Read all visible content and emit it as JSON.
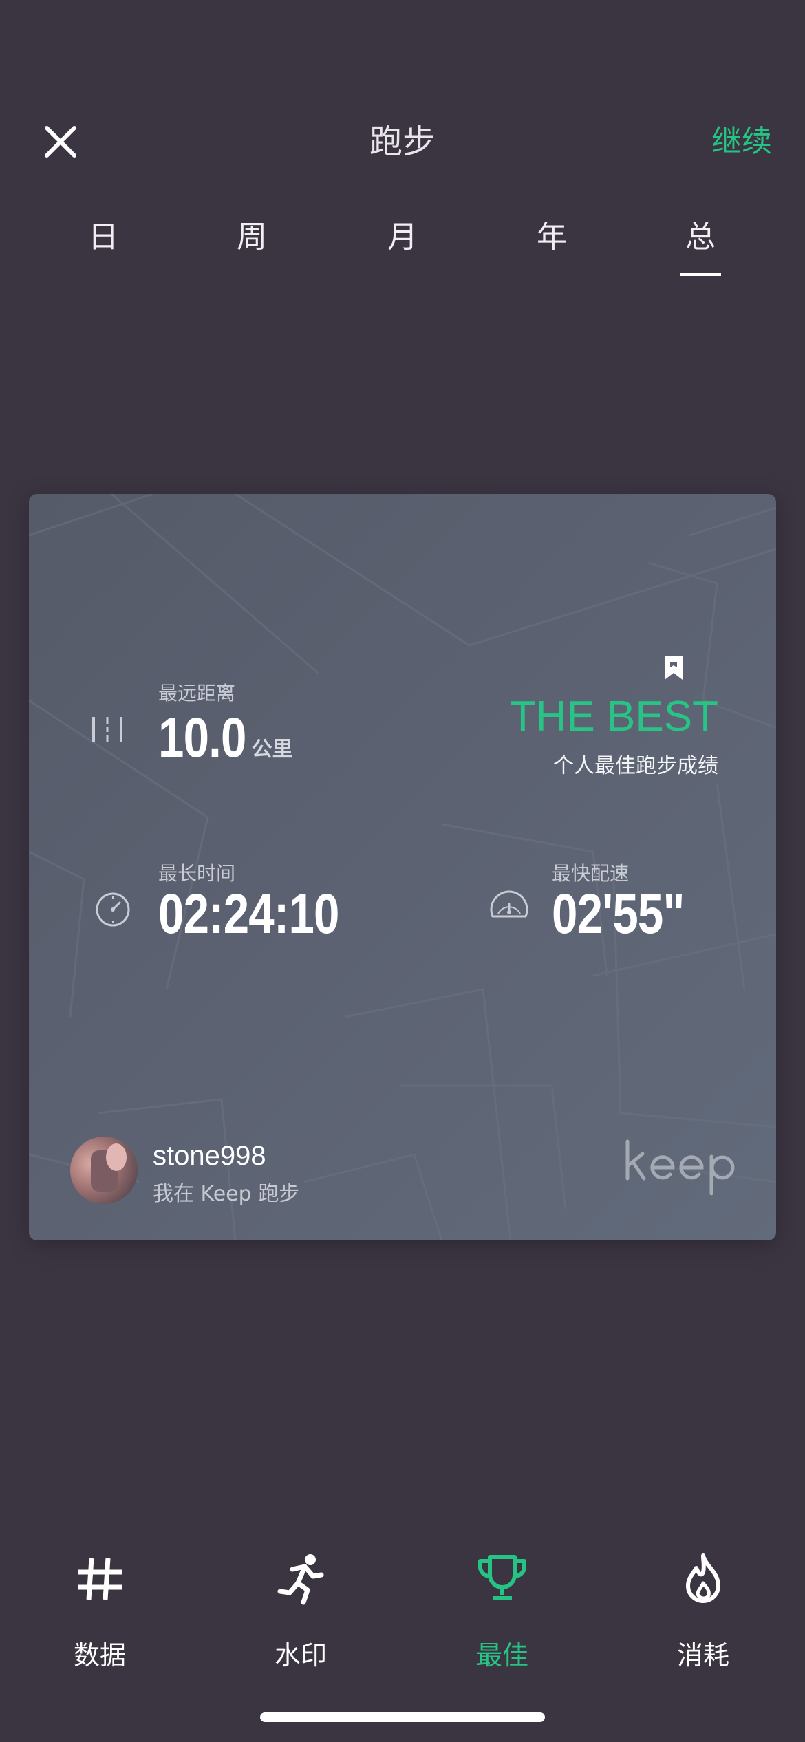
{
  "header": {
    "title": "跑步",
    "continue_label": "继续",
    "close_icon": "close-icon"
  },
  "tabs": [
    {
      "label": "日",
      "active": false
    },
    {
      "label": "周",
      "active": false
    },
    {
      "label": "月",
      "active": false
    },
    {
      "label": "年",
      "active": false
    },
    {
      "label": "总",
      "active": true
    }
  ],
  "card": {
    "longest_distance": {
      "label": "最远距离",
      "value": "10.0",
      "unit": "公里",
      "icon": "distance-icon"
    },
    "longest_time": {
      "label": "最长时间",
      "value": "02:24:10",
      "icon": "stopwatch-icon"
    },
    "fastest_pace": {
      "label": "最快配速",
      "value": "02'55\"",
      "icon": "speedometer-icon"
    },
    "best": {
      "title": "THE BEST",
      "subtitle": "个人最佳跑步成绩",
      "icon": "bookmark-icon"
    },
    "user": {
      "name": "stone998",
      "tagline": "我在 Keep 跑步"
    },
    "brand": "keep"
  },
  "bottom_nav": [
    {
      "label": "数据",
      "icon": "hashtag-icon",
      "active": false
    },
    {
      "label": "水印",
      "icon": "runner-icon",
      "active": false
    },
    {
      "label": "最佳",
      "icon": "trophy-icon",
      "active": true
    },
    {
      "label": "消耗",
      "icon": "flame-icon",
      "active": false
    }
  ],
  "colors": {
    "background": "#3b3542",
    "accent": "#26c484",
    "card": "#5c6272"
  }
}
